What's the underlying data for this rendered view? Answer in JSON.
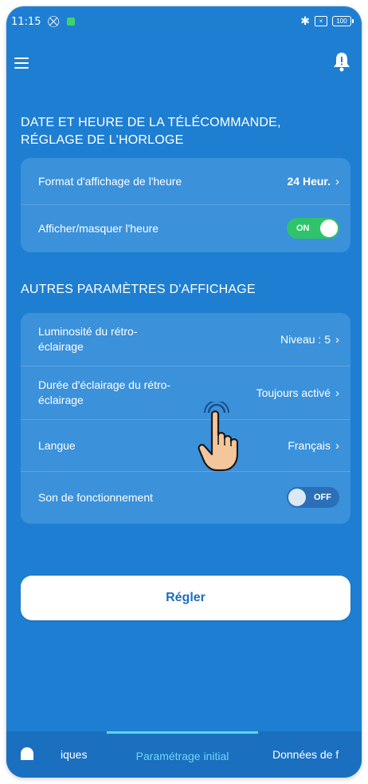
{
  "status_bar": {
    "time": "11:15",
    "battery": "100"
  },
  "section1": {
    "title_line1": "DATE ET HEURE DE LA TÉLÉCOMMANDE,",
    "title_line2": "RÉGLAGE DE L'HORLOGE",
    "rows": [
      {
        "label": "Format d'affichage de l'heure",
        "value": "24 Heur."
      },
      {
        "label": "Afficher/masquer l'heure",
        "toggle": "ON"
      }
    ]
  },
  "section2": {
    "title": "AUTRES PARAMÈTRES D'AFFICHAGE",
    "rows": [
      {
        "label_line1": "Luminosité du rétro-",
        "label_line2": "éclairage",
        "value": "Niveau : 5"
      },
      {
        "label_line1": "Durée d'éclairage du rétro-",
        "label_line2": "éclairage",
        "value": "Toujours activé"
      },
      {
        "label": "Langue",
        "value": "Français"
      },
      {
        "label": "Son de fonctionnement",
        "toggle": "OFF"
      }
    ]
  },
  "set_button": {
    "label": "Régler"
  },
  "tabs": [
    {
      "label": "iques"
    },
    {
      "label": "Paramétrage initial"
    },
    {
      "label": "Données de f"
    }
  ],
  "colors": {
    "background": "#1e7fd2",
    "card": "#3b91da",
    "toggle_on": "#2fc36b",
    "active_tab": "#6fd6f4"
  },
  "icons": [
    "menu-icon",
    "bell-icon",
    "home-icon",
    "hand-cursor-icon",
    "bluetooth-icon",
    "battery-icon"
  ]
}
